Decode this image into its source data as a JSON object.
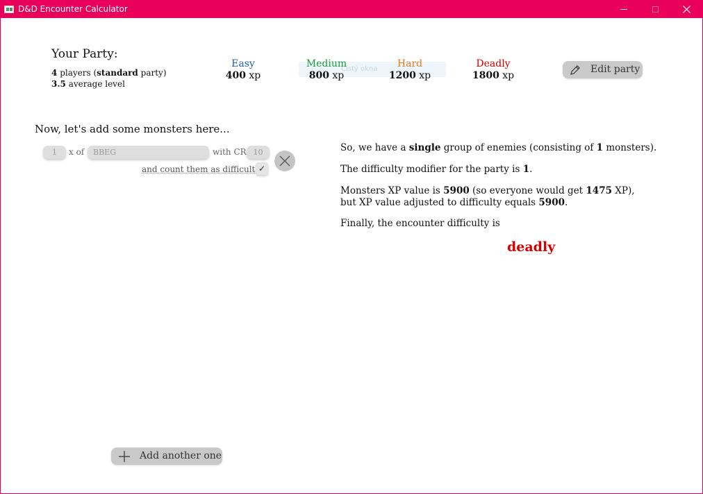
{
  "window": {
    "title": "D&D Encounter Calculator",
    "accent_color": "#e8005a"
  },
  "party": {
    "title": "Your Party:",
    "players_count": "4",
    "players_text": "players (",
    "party_type": "standard",
    "party_suffix": "party)",
    "average_level": "3.5",
    "average_level_text": "average level",
    "edit_button": "Edit party"
  },
  "thresholds": [
    {
      "name": "Easy",
      "xp": "400",
      "unit": "xp",
      "color": "#1f5fa8"
    },
    {
      "name": "Medium",
      "xp": "800",
      "unit": "xp",
      "color": "#1f9a3a"
    },
    {
      "name": "Hard",
      "xp": "1200",
      "unit": "xp",
      "color": "#e07a1f"
    },
    {
      "name": "Deadly",
      "xp": "1800",
      "unit": "xp",
      "color": "#d40000"
    }
  ],
  "ghost_text": "Čistý okna",
  "monsters": {
    "heading": "Now, let's add some monsters here...",
    "groups": [
      {
        "count": "1",
        "x_of": "x of",
        "name": "BBEG",
        "with_cr": "with CR",
        "cr": "10",
        "difficult_label": "and count them as difficult?",
        "difficult_checked": "✓"
      }
    ],
    "add_button": "Add another one"
  },
  "summary": {
    "l1_a": "So, we have a ",
    "l1_b": "single",
    "l1_c": " group of enemies (consisting of ",
    "l1_d": "1",
    "l1_e": " monsters).",
    "l2_a": "The difficulty modifier for the party is ",
    "l2_b": "1",
    "l2_c": ".",
    "l3_a": "Monsters XP value is ",
    "l3_b": "5900",
    "l3_c": " (so everyone would get ",
    "l3_d": "1475",
    "l3_e": " XP),",
    "l4_a": "but XP value adjusted to difficulty equals ",
    "l4_b": "5900",
    "l4_c": ".",
    "l5": "Finally, the encounter difficulty is",
    "result": "deadly",
    "result_color": "#d40000"
  }
}
